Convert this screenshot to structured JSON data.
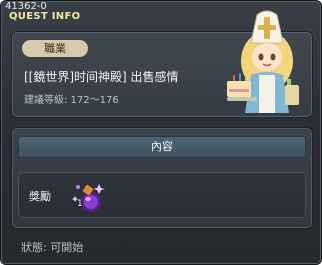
{
  "window": {
    "id_text": "41362-0",
    "title": "QUEST INFO"
  },
  "info": {
    "job_badge": "職業",
    "quest_name": "[[鏡世界]时间神殿] 出售感情",
    "level_range": "建議等級: 172～176"
  },
  "npc": {
    "icon": "npc-portrait-priestess"
  },
  "content": {
    "header": "內容",
    "reward_label": "獎勵",
    "reward_item": {
      "icon": "purple-potion-icon",
      "quantity": "1"
    }
  },
  "status": "狀態: 可開始",
  "colors": {
    "title": "#f4e79b",
    "badge_bg": "#d7c9a9",
    "header_bg": "#4f6573",
    "window_bg": "#2b3036"
  }
}
